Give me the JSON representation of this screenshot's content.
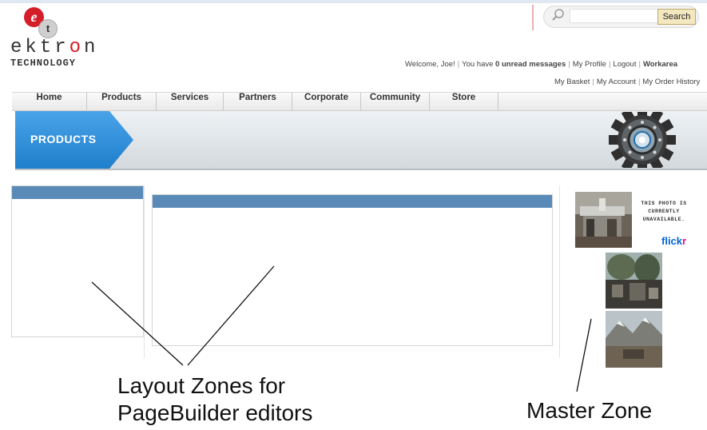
{
  "logo": {
    "badge_e": "e",
    "badge_t": "t",
    "word_parts": [
      "ektr",
      "o",
      "n"
    ],
    "sub": "TECHNOLOGY"
  },
  "search": {
    "input_value": "",
    "button_label": "Search",
    "icon": "search-icon"
  },
  "user_bar": {
    "welcome": "Welcome, Joe!",
    "messages_prefix": "You have ",
    "messages_bold": "0 unread messages",
    "my_profile": "My Profile",
    "logout": "Logout",
    "workarea": "Workarea",
    "my_basket": "My Basket",
    "my_account": "My Account",
    "my_order_history": "My Order History"
  },
  "nav": {
    "items": [
      "Home",
      "Products",
      "Services",
      "Partners",
      "Corporate",
      "Community",
      "Store"
    ]
  },
  "banner": {
    "title": "PRODUCTS",
    "accent_color": "#2f8fd8",
    "image": "gear-image"
  },
  "zones": {
    "header_color": "#5a8bb8"
  },
  "master_zone": {
    "photo_unavailable_text": [
      "THIS PHOTO IS",
      "CURRENTLY",
      "UNAVAILABLE."
    ],
    "flickr_parts": [
      "flick",
      "r"
    ]
  },
  "annotations": {
    "layout_zones_line1": "Layout Zones for",
    "layout_zones_line2": "PageBuilder editors",
    "master_zone": "Master Zone"
  }
}
